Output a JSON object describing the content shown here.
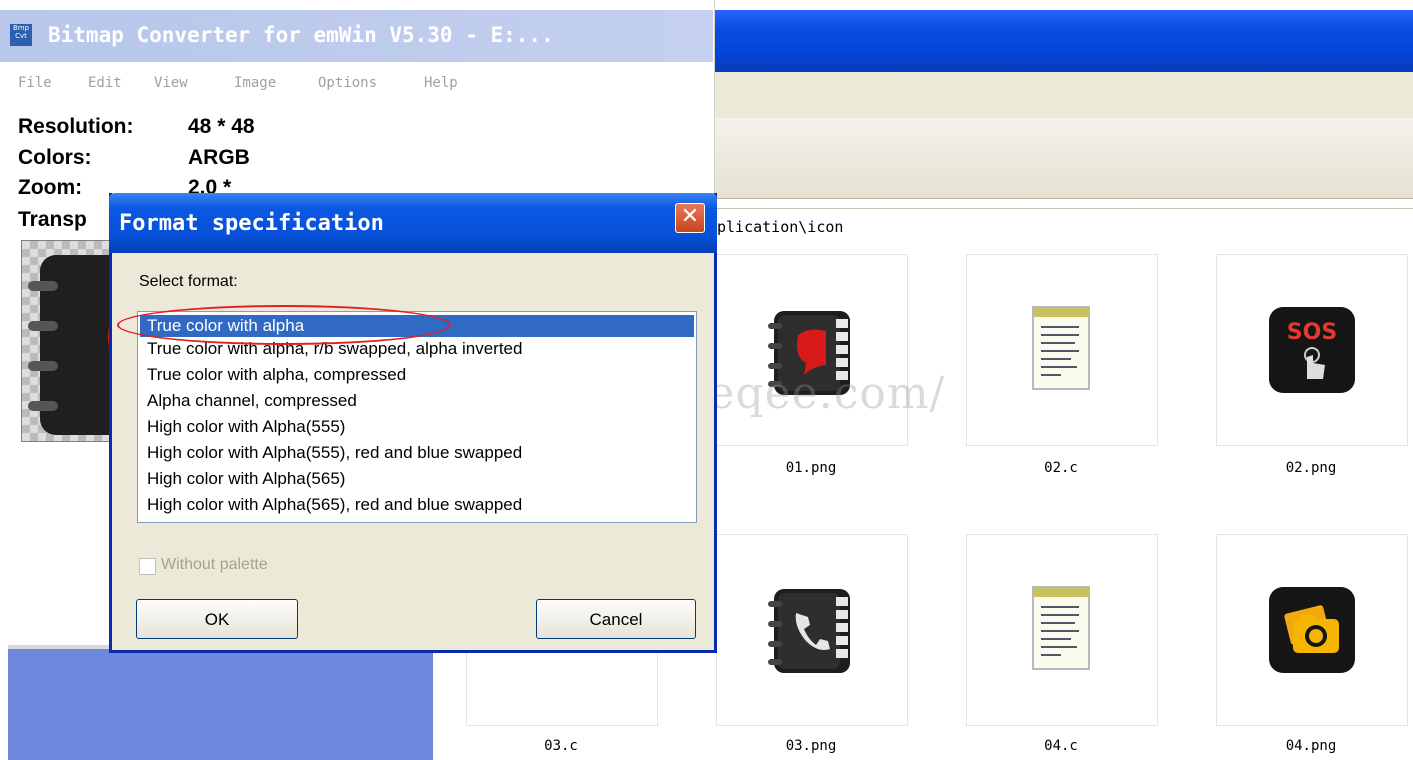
{
  "explorer": {
    "address_path": "plication\\icon",
    "watermark": "http://www.neqee.com/",
    "files": [
      {
        "label": "01.png",
        "icon": "notebook-chat-icon"
      },
      {
        "label": "02.c",
        "icon": "text-document-icon"
      },
      {
        "label": "02.png",
        "icon": "sos-touch-icon"
      },
      {
        "label": "03.c",
        "icon": "text-document-icon"
      },
      {
        "label": "03.png",
        "icon": "phonebook-icon"
      },
      {
        "label": "04.c",
        "icon": "text-document-icon"
      },
      {
        "label": "04.png",
        "icon": "camera-icon"
      }
    ]
  },
  "bitmap_converter": {
    "app_icon_text": "Bmp Cvt",
    "title": "Bitmap Converter for emWin V5.30 - E:...",
    "menu": [
      "File",
      "Edit",
      "View",
      "Image",
      "Options",
      "Help"
    ],
    "info": {
      "resolution_label": "Resolution:",
      "resolution_value": "48 * 48",
      "colors_label": "Colors:",
      "colors_value": "ARGB",
      "zoom_label": "Zoom:",
      "zoom_value": "2.0 *",
      "transparency_label": "Transp"
    }
  },
  "dialog": {
    "title": "Format specification",
    "close_label": "✕",
    "select_label": "Select format:",
    "formats": [
      "True color with alpha",
      "True color with alpha, r/b swapped, alpha inverted",
      "True color with alpha, compressed",
      "Alpha channel, compressed",
      "High color with Alpha(555)",
      "High color with Alpha(555), red and blue swapped",
      "High color with Alpha(565)",
      "High color with Alpha(565), red and blue swapped"
    ],
    "selected_index": 0,
    "without_palette_label": "Without palette",
    "without_palette_checked": false,
    "ok_label": "OK",
    "cancel_label": "Cancel"
  },
  "colors": {
    "xp_blue": "#0750d8",
    "selection": "#316ac5",
    "annotation_red": "#e02020",
    "dialog_face": "#ece9d8"
  }
}
